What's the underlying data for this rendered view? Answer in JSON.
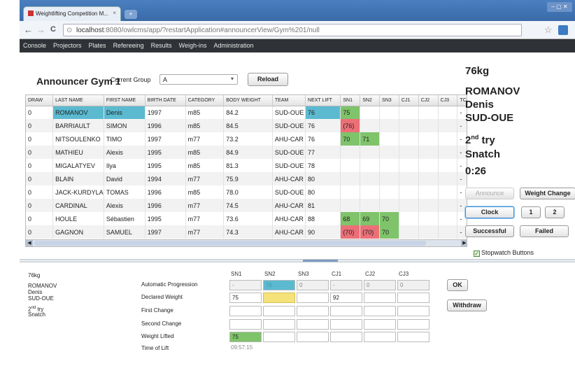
{
  "browser": {
    "tab_title": "Weightlifting Competition M...",
    "tab_close": "×",
    "new_tab": "+",
    "window_controls": "– ▢ ✕",
    "back": "←",
    "forward": "→",
    "reload": "C",
    "url_host": "localhost",
    "url_rest": ":8080/owlcms/app/?restartApplication#announcerView/Gym%201/null",
    "star": "☆"
  },
  "menu": [
    "Console",
    "Projectors",
    "Plates",
    "Refereeing",
    "Results",
    "Weigh-ins",
    "Administration"
  ],
  "announcer": {
    "title": "Announcer Gym 1",
    "current_group_label": "Current Group",
    "group_value": "A",
    "reload_label": "Reload"
  },
  "table": {
    "headers": [
      "DRAW",
      "LAST NAME",
      "FIRST NAME",
      "BIRTH DATE",
      "CATEGORY",
      "BODY WEIGHT",
      "TEAM",
      "NEXT LIFT",
      "SN1",
      "SN2",
      "SN3",
      "CJ1",
      "CJ2",
      "CJ3",
      "TC"
    ],
    "rows": [
      {
        "draw": "0",
        "last": "ROMANOV",
        "first": "Denis",
        "birth": "1997",
        "cat": "m85",
        "bw": "84.2",
        "team": "SUD-OUE",
        "next": "76",
        "sn1": "75",
        "sn2": "",
        "sn3": "",
        "tc": "-"
      },
      {
        "draw": "0",
        "last": "BARRIAULT",
        "first": "SIMON",
        "birth": "1996",
        "cat": "m85",
        "bw": "84.5",
        "team": "SUD-OUE",
        "next": "76",
        "sn1": "(76)",
        "sn2": "",
        "sn3": "",
        "tc": "-"
      },
      {
        "draw": "0",
        "last": "NITSOULENKO",
        "first": "TIMO",
        "birth": "1997",
        "cat": "m77",
        "bw": "73.2",
        "team": "AHU-CAR",
        "next": "76",
        "sn1": "70",
        "sn2": "71",
        "sn3": "",
        "tc": "-"
      },
      {
        "draw": "0",
        "last": "MATHIEU",
        "first": "Alexis",
        "birth": "1995",
        "cat": "m85",
        "bw": "84.9",
        "team": "SUD-OUE",
        "next": "77",
        "sn1": "",
        "sn2": "",
        "sn3": "",
        "tc": "-"
      },
      {
        "draw": "0",
        "last": "MIGALATYEV",
        "first": "Ilya",
        "birth": "1995",
        "cat": "m85",
        "bw": "81.3",
        "team": "SUD-OUE",
        "next": "78",
        "sn1": "",
        "sn2": "",
        "sn3": "",
        "tc": "-"
      },
      {
        "draw": "0",
        "last": "BLAIN",
        "first": "David",
        "birth": "1994",
        "cat": "m77",
        "bw": "75.9",
        "team": "AHU-CAR",
        "next": "80",
        "sn1": "",
        "sn2": "",
        "sn3": "",
        "tc": "-"
      },
      {
        "draw": "0",
        "last": "JACK-KURDYLA",
        "first": "TOMAS",
        "birth": "1996",
        "cat": "m85",
        "bw": "78.0",
        "team": "SUD-OUE",
        "next": "80",
        "sn1": "",
        "sn2": "",
        "sn3": "",
        "tc": "-"
      },
      {
        "draw": "0",
        "last": "CARDINAL",
        "first": "Alexis",
        "birth": "1996",
        "cat": "m77",
        "bw": "74.5",
        "team": "AHU-CAR",
        "next": "81",
        "sn1": "",
        "sn2": "",
        "sn3": "",
        "tc": "-"
      },
      {
        "draw": "0",
        "last": "HOULE",
        "first": "Sébastien",
        "birth": "1995",
        "cat": "m77",
        "bw": "73.6",
        "team": "AHU-CAR",
        "next": "88",
        "sn1": "68",
        "sn2": "69",
        "sn3": "70",
        "tc": "-"
      },
      {
        "draw": "0",
        "last": "GAGNON",
        "first": "SAMUEL",
        "birth": "1997",
        "cat": "m77",
        "bw": "74.3",
        "team": "AHU-CAR",
        "next": "90",
        "sn1": "(70)",
        "sn2": "(70)",
        "sn3": "70",
        "tc": "-"
      }
    ],
    "status_colors": {
      "current": "#5bbad0",
      "good": "#7fc36a",
      "bad": "#ec6f77"
    }
  },
  "current_lifter": {
    "category": "76kg",
    "last": "ROMANOV",
    "first": "Denis",
    "team": "SUD-OUE",
    "attempt_num": "2",
    "attempt_sup": "nd",
    "attempt_word": "try",
    "lift": "Snatch",
    "time": "0:26"
  },
  "controls": {
    "announce": "Announce",
    "weight_change": "Weight Change",
    "clock": "Clock",
    "one": "1",
    "two": "2",
    "successful": "Successful",
    "failed": "Failed",
    "stopwatch_check": "✓",
    "stopwatch": "Stopwatch Buttons"
  },
  "lower": {
    "category": "76kg",
    "last": "ROMANOV",
    "first": "Denis",
    "team": "SUD-OUE",
    "attempt_num": "2",
    "attempt_sup": "nd",
    "attempt_word": "try",
    "lift": "Snatch",
    "field_labels": [
      "Automatic Progression",
      "Declared Weight",
      "First Change",
      "Second Change",
      "Weight Lifted",
      "Time of Lift"
    ],
    "col_headers": [
      "SN1",
      "SN2",
      "SN3",
      "CJ1",
      "CJ2",
      "CJ3"
    ],
    "auto_prog": [
      "-",
      "76",
      "0",
      "-",
      "0",
      "0"
    ],
    "declared": [
      "75",
      "",
      "",
      "92",
      "",
      ""
    ],
    "lifted": [
      "75",
      "",
      "",
      "",
      "",
      ""
    ],
    "time_of_lift": "09:57:15",
    "ok": "OK",
    "withdraw": "Withdraw"
  }
}
